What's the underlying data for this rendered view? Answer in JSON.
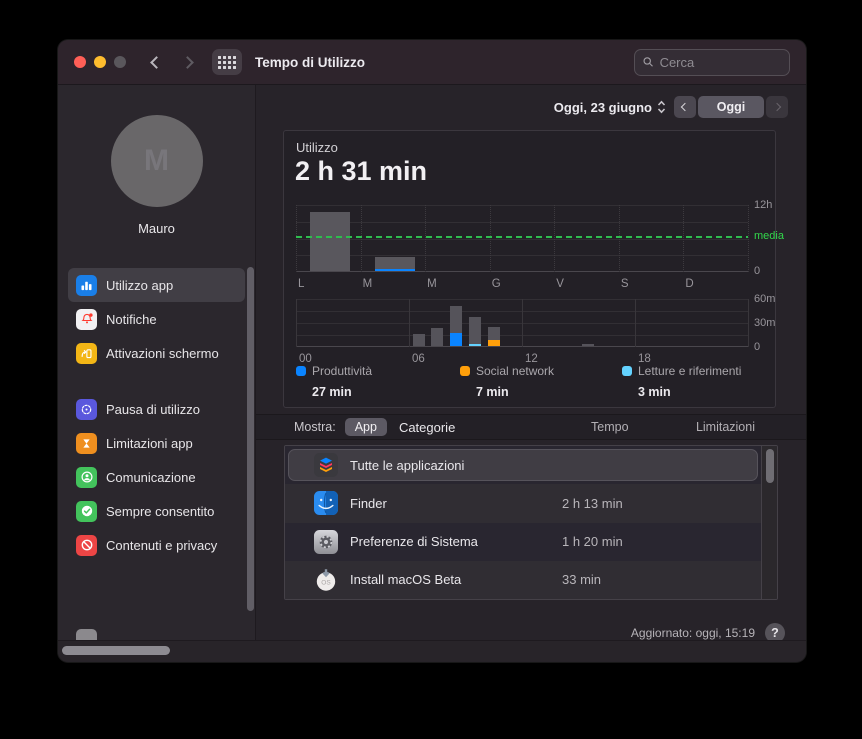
{
  "window": {
    "title": "Tempo di Utilizzo",
    "search_placeholder": "Cerca"
  },
  "toolbar": {
    "date_label": "Oggi, 23 giugno",
    "prev_label": "previous-day",
    "today_button": "Oggi",
    "next_label": "next-day"
  },
  "sidebar": {
    "user": "Mauro",
    "monogram": "M",
    "items": [
      {
        "id": "utilizzo-app",
        "label": "Utilizzo app",
        "icon": "app-usage",
        "color": "#1a7fe8",
        "selected": true,
        "group": 1
      },
      {
        "id": "notifiche",
        "label": "Notifiche",
        "icon": "notifications",
        "color": "#f2f1f3",
        "selected": false,
        "group": 1
      },
      {
        "id": "attivazioni-schermo",
        "label": "Attivazioni schermo",
        "icon": "pickups",
        "color": "#f3b616",
        "selected": false,
        "group": 1
      },
      {
        "id": "pausa-di-utilizzo",
        "label": "Pausa di utilizzo",
        "icon": "downtime",
        "color": "#5a58dd",
        "selected": false,
        "group": 2
      },
      {
        "id": "limitazioni-app",
        "label": "Limitazioni app",
        "icon": "app-limits",
        "color": "#ef8f1f",
        "selected": false,
        "group": 2
      },
      {
        "id": "comunicazione",
        "label": "Comunicazione",
        "icon": "communication",
        "color": "#43c35c",
        "selected": false,
        "group": 2
      },
      {
        "id": "sempre-consentito",
        "label": "Sempre consentito",
        "icon": "always-allowed",
        "color": "#43c35c",
        "selected": false,
        "group": 2
      },
      {
        "id": "contenuti-e-privacy",
        "label": "Contenuti e privacy",
        "icon": "content-privacy",
        "color": "#ed4545",
        "selected": false,
        "group": 2
      }
    ]
  },
  "usage": {
    "label": "Utilizzo",
    "total": "2 h 31 min"
  },
  "legend": [
    {
      "label": "Produttività",
      "value": "27 min",
      "color": "#0a84ff"
    },
    {
      "label": "Social network",
      "value": "7 min",
      "color": "#ff9f0a"
    },
    {
      "label": "Letture e riferimenti",
      "value": "3 min",
      "color": "#64d2ff"
    }
  ],
  "mostra": {
    "label": "Mostra:",
    "options": [
      "App",
      "Categorie"
    ],
    "selected": "App",
    "col_time": "Tempo",
    "col_limits": "Limitazioni"
  },
  "apps": [
    {
      "name": "Tutte le applicazioni",
      "time": "",
      "icon": "all-apps",
      "selected": true
    },
    {
      "name": "Finder",
      "time": "2 h 13 min",
      "icon": "finder",
      "selected": false
    },
    {
      "name": "Preferenze di Sistema",
      "time": "1 h 20 min",
      "icon": "system-prefs",
      "selected": false
    },
    {
      "name": "Install macOS Beta",
      "time": "33 min",
      "icon": "install-beta",
      "selected": false
    }
  ],
  "footer": {
    "updated": "Aggiornato: oggi, 15:19",
    "help": "?"
  },
  "chart_data": [
    {
      "type": "bar",
      "title": "Utilizzo settimanale (ore)",
      "categories": [
        "L",
        "M",
        "M",
        "G",
        "V",
        "S",
        "D"
      ],
      "series": [
        {
          "name": "totale_ore",
          "values": [
            10.6,
            2.5,
            0,
            0,
            0,
            0,
            0
          ]
        },
        {
          "name": "produttivita_ore",
          "values": [
            0,
            0.45,
            0,
            0,
            0,
            0,
            0
          ]
        }
      ],
      "average_line": {
        "label": "media",
        "value": 6.5
      },
      "ylim": [
        0,
        12
      ],
      "y_ticks": [
        "12h",
        "0"
      ],
      "bar_color": "#59575d",
      "highlight_color": "#0a84ff"
    },
    {
      "type": "bar",
      "title": "Utilizzo orario (minuti)",
      "x_ticks": [
        "00",
        "06",
        "12",
        "18"
      ],
      "x_tick_hours": [
        0,
        6,
        12,
        18
      ],
      "ylim_minutes": [
        0,
        60
      ],
      "y_ticks": [
        "60m",
        "30m",
        "0"
      ],
      "bars": [
        {
          "hour": 6,
          "segments": [
            {
              "category": "altro",
              "minutes": 15
            }
          ]
        },
        {
          "hour": 7,
          "segments": [
            {
              "category": "altro",
              "minutes": 22
            }
          ]
        },
        {
          "hour": 8,
          "segments": [
            {
              "category": "produttivita",
              "minutes": 16
            },
            {
              "category": "altro",
              "minutes": 34
            }
          ]
        },
        {
          "hour": 9,
          "segments": [
            {
              "category": "letture",
              "minutes": 3
            },
            {
              "category": "altro",
              "minutes": 33
            }
          ]
        },
        {
          "hour": 10,
          "segments": [
            {
              "category": "social",
              "minutes": 7
            },
            {
              "category": "altro",
              "minutes": 17
            }
          ]
        },
        {
          "hour": 15,
          "segments": [
            {
              "category": "altro",
              "minutes": 2
            }
          ]
        }
      ],
      "colors": {
        "produttivita": "#0a84ff",
        "social": "#ff9f0a",
        "letture": "#64d2ff",
        "altro": "#55535a"
      }
    }
  ],
  "colors": {
    "accent_blue": "#0a84ff",
    "green": "#30d158",
    "traffic": [
      "#ff5f57",
      "#febc2e",
      "#5a575c"
    ]
  }
}
